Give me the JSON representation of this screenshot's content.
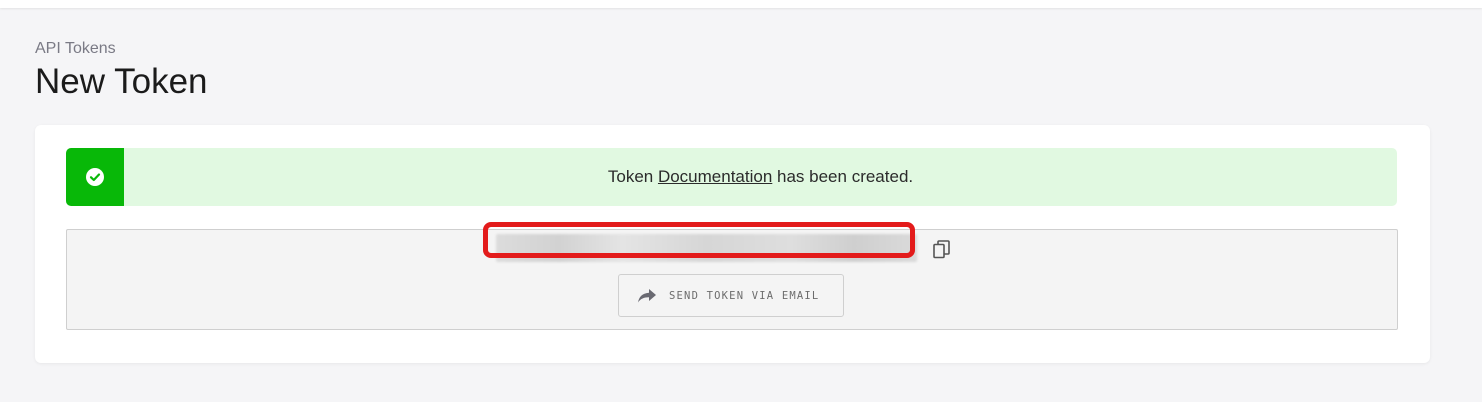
{
  "header": {
    "breadcrumb": "API Tokens",
    "title": "New Token"
  },
  "alert": {
    "prefix": "Token ",
    "token_name": "Documentation",
    "suffix": " has been created.",
    "icon": "check-circle-icon",
    "color": "#08b808",
    "background": "#e1f9e1"
  },
  "token": {
    "value_state": "blurred",
    "highlight_color": "#e31b1b",
    "copy_icon": "copy-icon"
  },
  "actions": {
    "send_email_label": "SEND TOKEN VIA EMAIL",
    "send_email_icon": "share-arrow-icon"
  }
}
